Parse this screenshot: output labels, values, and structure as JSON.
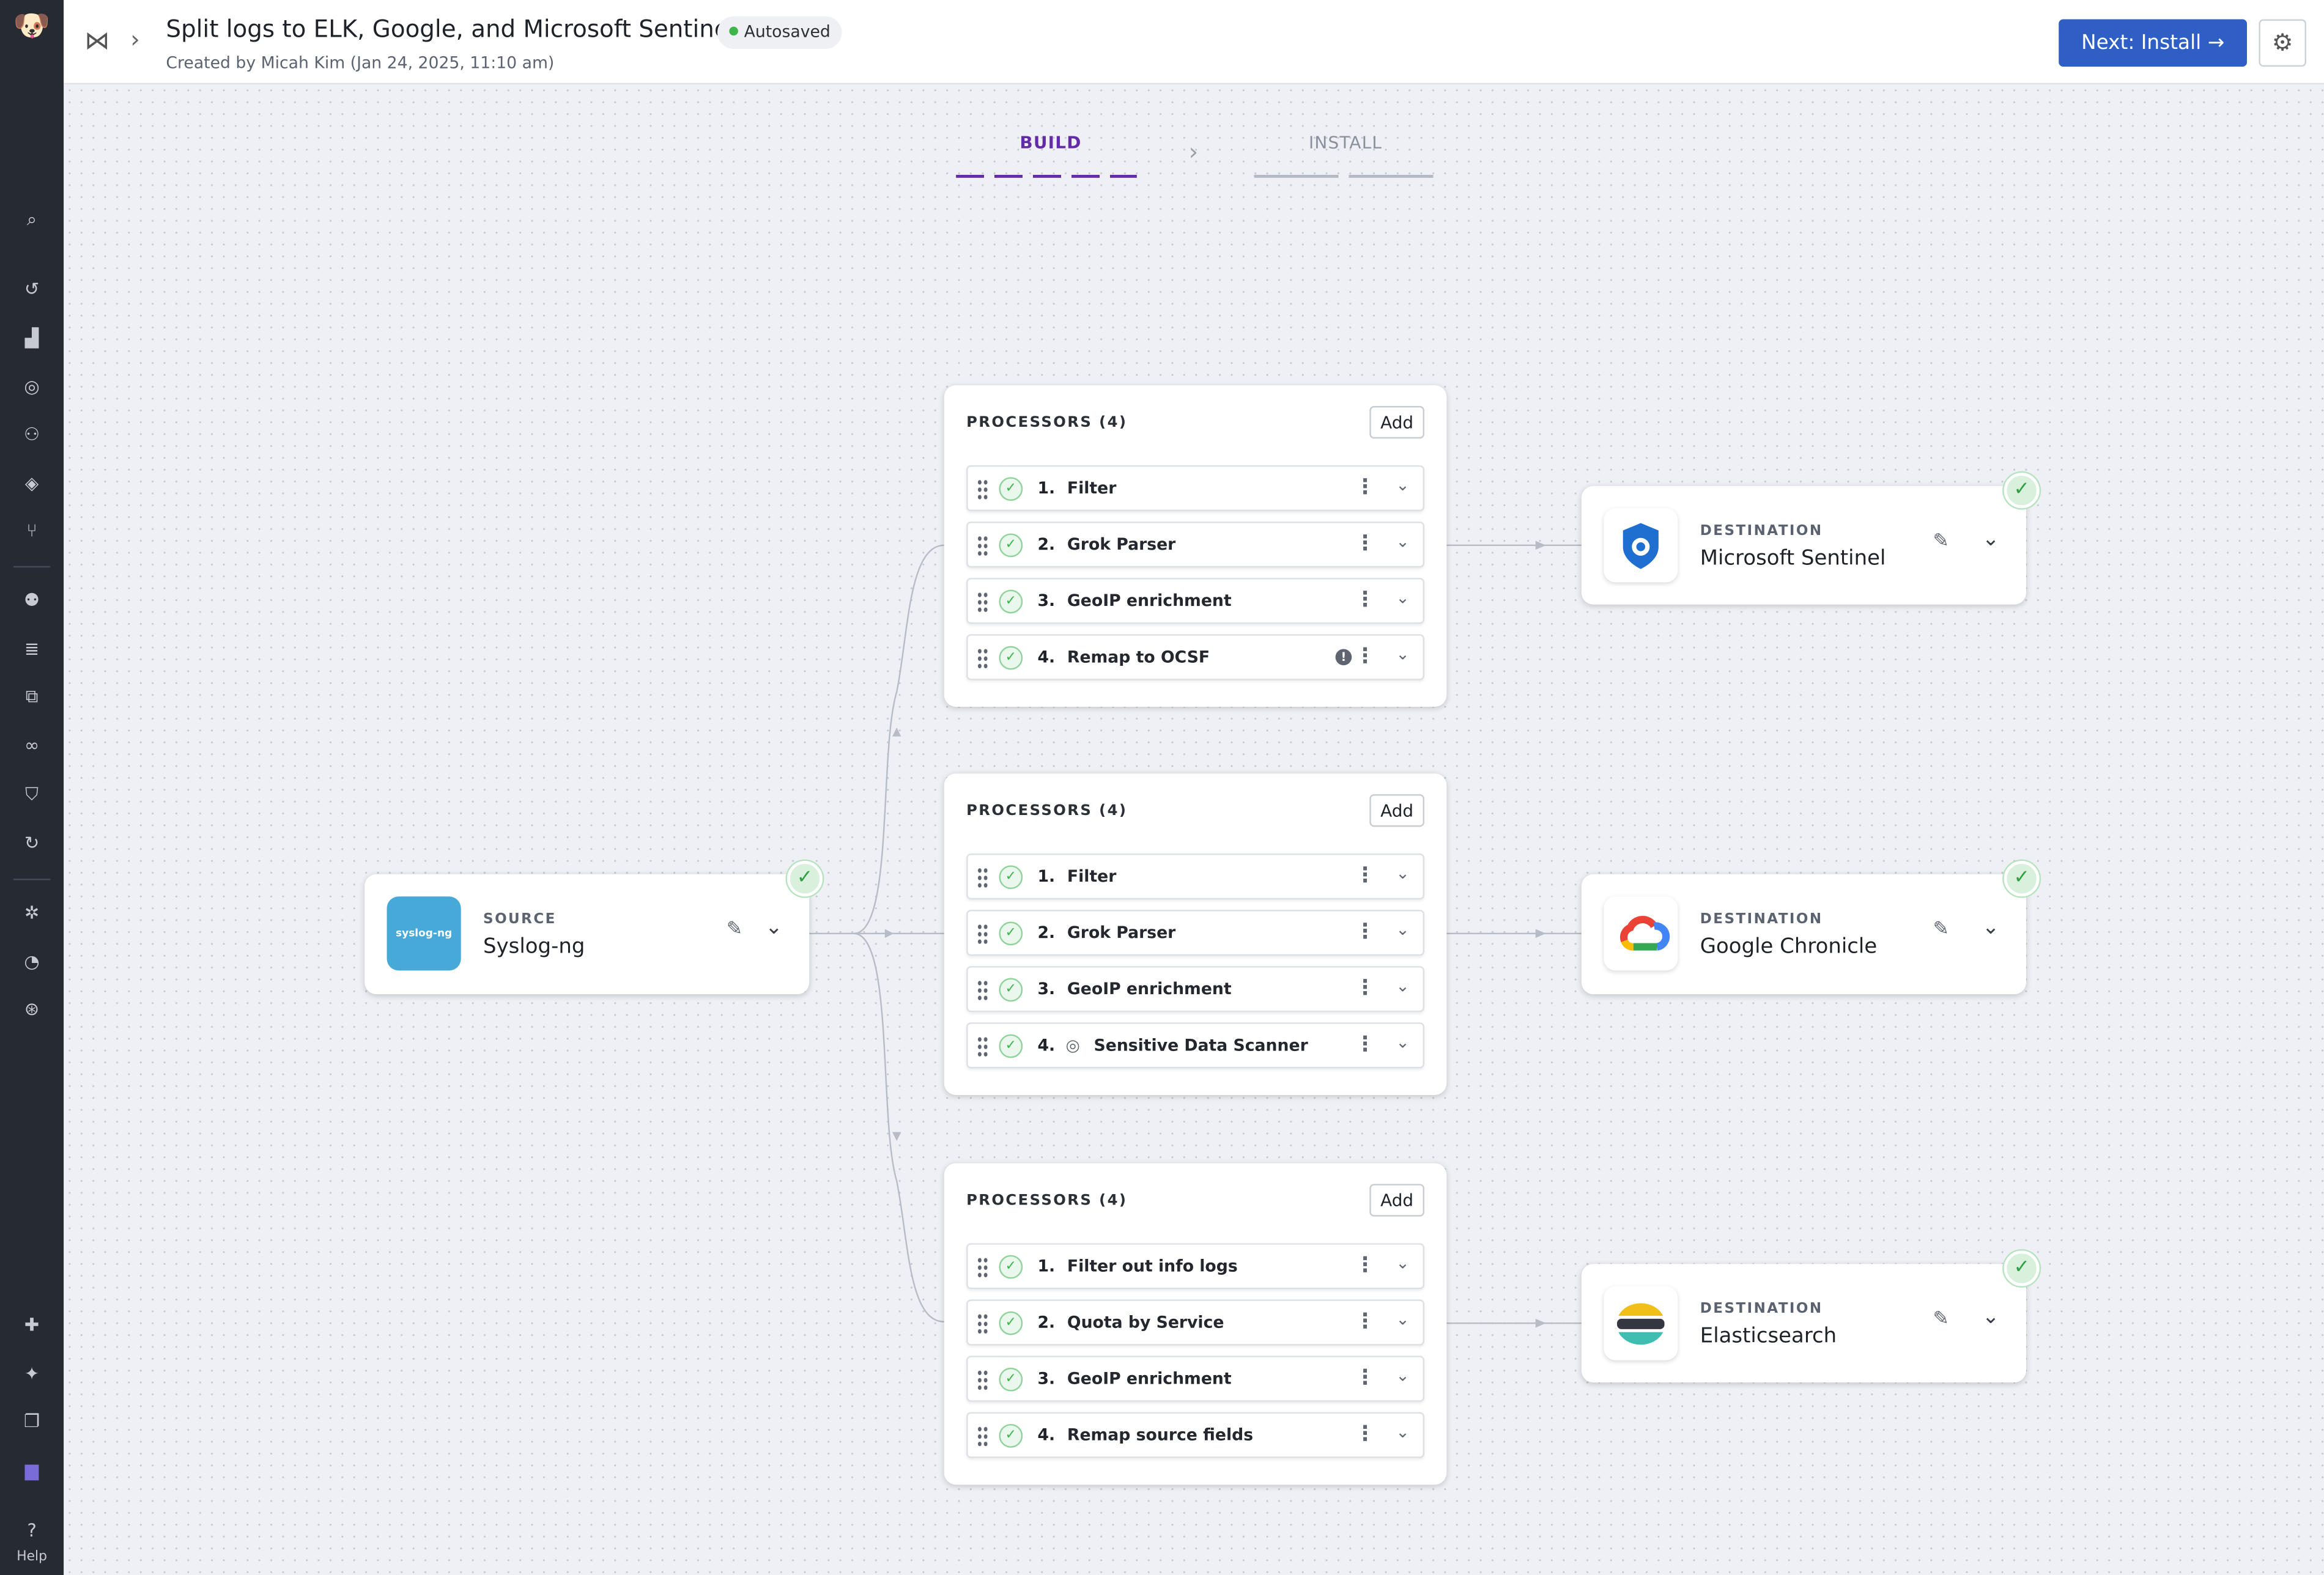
{
  "header": {
    "title": "Split logs to ELK, Google, and Microsoft Sentinel",
    "autosave": "Autosaved",
    "subtitle": "Created by Micah Kim (Jan 24, 2025, 11:10 am)",
    "next_button": "Next: Install",
    "next_arrow": "→",
    "gear": "⚙",
    "chevron": "›"
  },
  "sidebar": {
    "help": "Help"
  },
  "steps": {
    "build": "BUILD",
    "install": "INSTALL",
    "separator": "›",
    "active": "build"
  },
  "colors": {
    "accent": "#632ca6",
    "primary": "#2f5fc4",
    "success": "#3db54a"
  },
  "source": {
    "label": "SOURCE",
    "name": "Syslog-ng",
    "logo_text": "syslog-ng",
    "status": "ok"
  },
  "processor_groups": [
    {
      "title": "PROCESSORS (4)",
      "add": "Add",
      "items": [
        {
          "num": "1.",
          "name": "Filter"
        },
        {
          "num": "2.",
          "name": "Grok Parser"
        },
        {
          "num": "3.",
          "name": "GeoIP enrichment"
        },
        {
          "num": "4.",
          "name": "Remap to OCSF",
          "warning": true
        }
      ]
    },
    {
      "title": "PROCESSORS (4)",
      "add": "Add",
      "items": [
        {
          "num": "1.",
          "name": "Filter"
        },
        {
          "num": "2.",
          "name": "Grok Parser"
        },
        {
          "num": "3.",
          "name": "GeoIP enrichment"
        },
        {
          "num": "4.",
          "name": "Sensitive Data Scanner",
          "icon": "scanner"
        }
      ]
    },
    {
      "title": "PROCESSORS (4)",
      "add": "Add",
      "items": [
        {
          "num": "1.",
          "name": "Filter out info logs"
        },
        {
          "num": "2.",
          "name": "Quota by Service"
        },
        {
          "num": "3.",
          "name": "GeoIP enrichment"
        },
        {
          "num": "4.",
          "name": "Remap source fields"
        }
      ]
    }
  ],
  "destinations": [
    {
      "label": "DESTINATION",
      "name": "Microsoft Sentinel",
      "status": "ok"
    },
    {
      "label": "DESTINATION",
      "name": "Google Chronicle",
      "status": "ok"
    },
    {
      "label": "DESTINATION",
      "name": "Elasticsearch",
      "status": "ok"
    }
  ]
}
